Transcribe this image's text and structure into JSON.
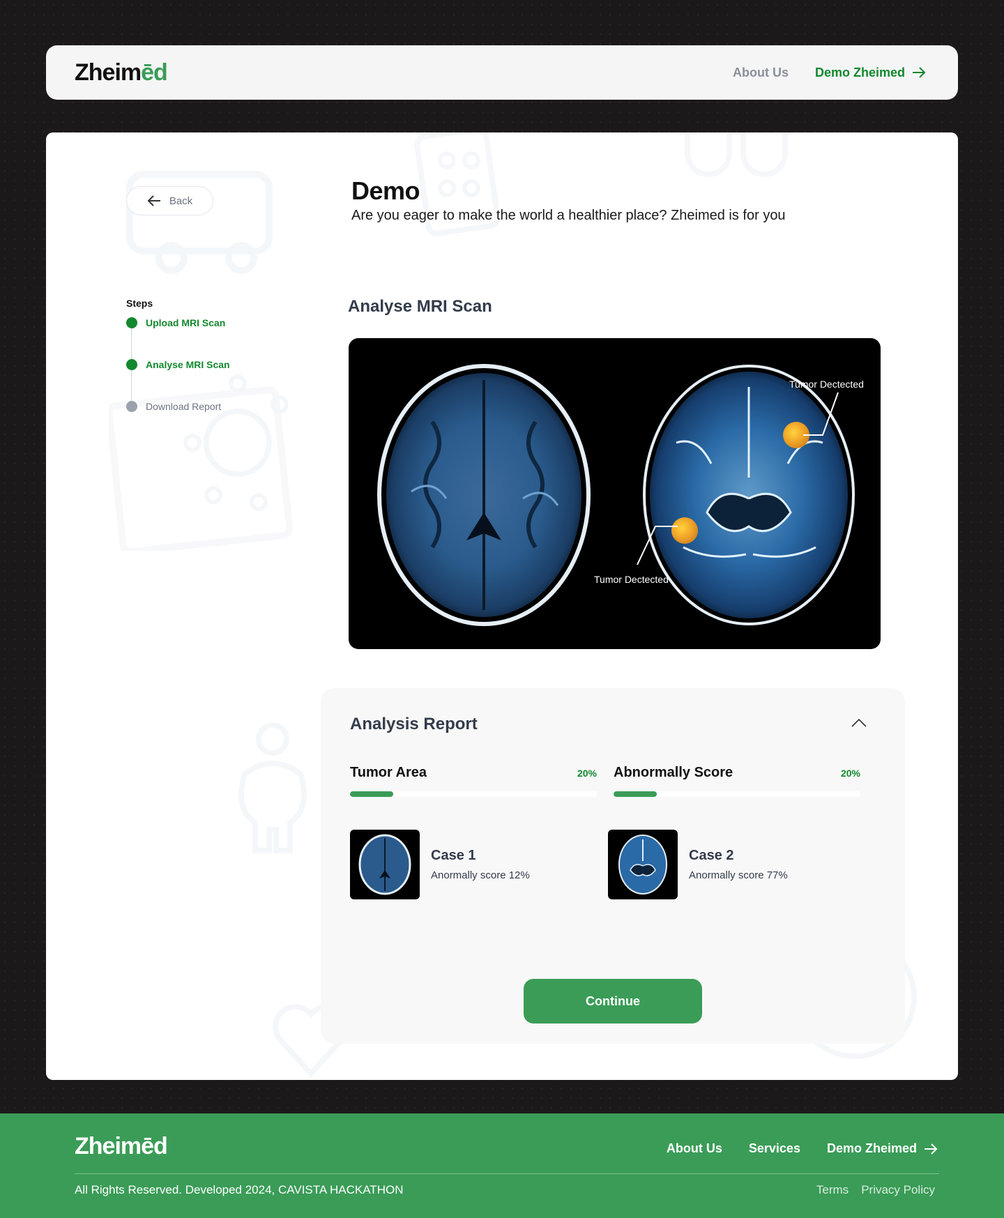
{
  "header": {
    "logo_main": "Zheim",
    "logo_accent": "ēd",
    "nav_about": "About Us",
    "nav_demo": "Demo Zheimed"
  },
  "sidebar": {
    "back_label": "Back",
    "steps_label": "Steps",
    "steps": [
      {
        "label": "Upload MRI Scan",
        "status": "done"
      },
      {
        "label": "Analyse MRI Scan",
        "status": "done"
      },
      {
        "label": "Download Report",
        "status": "pending"
      }
    ]
  },
  "main": {
    "title": "Demo",
    "subtitle": "Are you eager to make the world a healthier place? Zheimed is for you",
    "section_title": "Analyse MRI Scan",
    "tumor_label_1": "Tumor Dectected",
    "tumor_label_2": "Tumor Dectected"
  },
  "report": {
    "title": "Analysis Report",
    "metrics": [
      {
        "name": "Tumor Area",
        "value": "20%",
        "fraction": 0.175
      },
      {
        "name": "Abnormally Score",
        "value": "20%",
        "fraction": 0.175
      }
    ],
    "cases": [
      {
        "name": "Case 1",
        "score": "Anormally score 12%"
      },
      {
        "name": "Case 2",
        "score": "Anormally score 77%"
      }
    ],
    "continue_label": "Continue"
  },
  "footer": {
    "logo": "Zheimēd",
    "links": [
      "About Us",
      "Services",
      "Demo Zheimed"
    ],
    "copyright": "All Rights Reserved. Developed 2024, CAVISTA HACKATHON",
    "legal": [
      "Terms",
      "Privacy Policy"
    ]
  },
  "colors": {
    "brand_green": "#3a9c57",
    "dark_green": "#12882f",
    "background": "#1c191b"
  }
}
